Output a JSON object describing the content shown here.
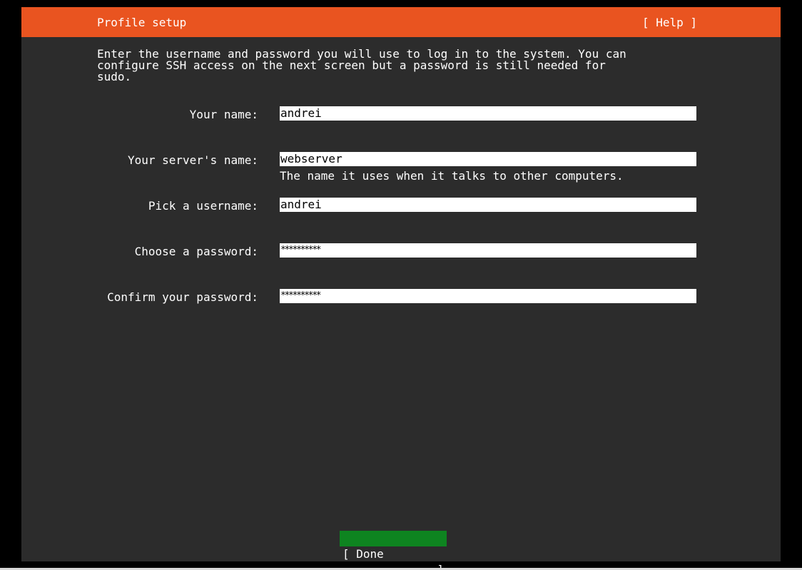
{
  "header": {
    "title": "Profile setup",
    "help_label": "[ Help ]"
  },
  "intro_text": "Enter the username and password you will use to log in to the system. You can\nconfigure SSH access on the next screen but a password is still needed for\nsudo.",
  "form": {
    "your_name": {
      "label": "Your name:",
      "value": "andrei"
    },
    "server_name": {
      "label": "Your server's name:",
      "value": "webserver",
      "hint": "The name it uses when it talks to other computers."
    },
    "username": {
      "label": "Pick a username:",
      "value": "andrei"
    },
    "password": {
      "label": "Choose a password:",
      "value": "**********"
    },
    "confirm_password": {
      "label": "Confirm your password:",
      "value": "**********"
    }
  },
  "done_button": {
    "left": "[ Done",
    "right": "]"
  },
  "colors": {
    "header_bg": "#e95420",
    "body_bg": "#2c2c2c",
    "done_bg": "#0e8420"
  }
}
